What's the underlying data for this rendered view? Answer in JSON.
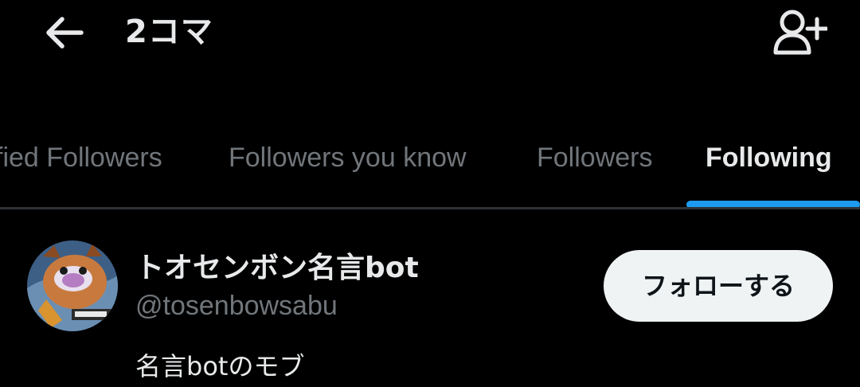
{
  "header": {
    "title": "2コマ",
    "back_icon": "arrow-left-icon",
    "add_user_icon": "person-plus-icon"
  },
  "tabs": [
    {
      "label": "fied Followers",
      "active": false
    },
    {
      "label": "Followers you know",
      "active": false
    },
    {
      "label": "Followers",
      "active": false
    },
    {
      "label": "Following",
      "active": true
    }
  ],
  "users": [
    {
      "name": "トオセンボン名言bot",
      "handle": "@tosenbowsabu",
      "bio": "名言botのモブ",
      "follow_label": "フォローする"
    }
  ],
  "colors": {
    "background": "#000000",
    "primary_text": "#e7e9ea",
    "secondary_text": "#71767b",
    "accent": "#1d9bf0",
    "divider": "#2f3336",
    "button_bg": "#eff3f4",
    "button_text": "#0f1419"
  }
}
